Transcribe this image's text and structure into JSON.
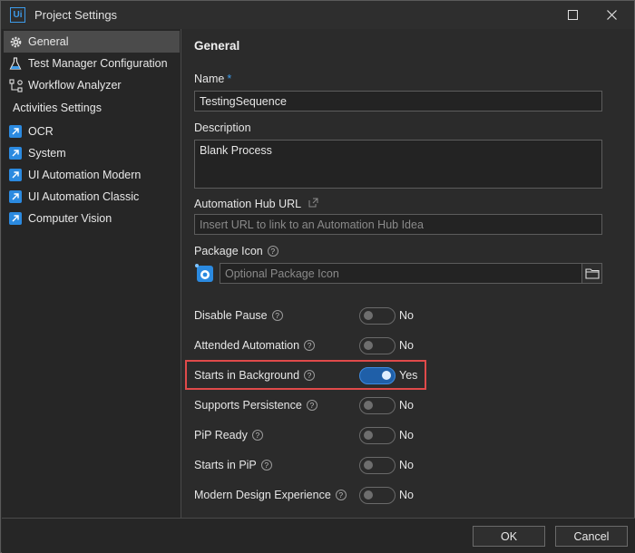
{
  "window": {
    "title": "Project Settings",
    "logo_text": "Ui"
  },
  "sidebar": {
    "items": [
      {
        "label": "General",
        "icon": "gear-icon",
        "active": true
      },
      {
        "label": "Test Manager Configuration",
        "icon": "flask-icon"
      },
      {
        "label": "Workflow Analyzer",
        "icon": "workflow-icon"
      }
    ],
    "activities_heading": "Activities Settings",
    "activities": [
      {
        "label": "OCR",
        "icon": "activity-package-icon"
      },
      {
        "label": "System",
        "icon": "activity-package-icon"
      },
      {
        "label": "UI Automation Modern",
        "icon": "activity-package-icon"
      },
      {
        "label": "UI Automation Classic",
        "icon": "activity-package-icon"
      },
      {
        "label": "Computer Vision",
        "icon": "activity-package-icon"
      }
    ]
  },
  "main": {
    "title": "General",
    "name_label": "Name",
    "name_required": "*",
    "name_value": "TestingSequence",
    "description_label": "Description",
    "description_value": "Blank Process",
    "hub_label": "Automation Hub URL",
    "hub_placeholder": "Insert URL to link to an Automation Hub Idea",
    "package_icon_label": "Package Icon",
    "package_icon_placeholder": "Optional Package Icon",
    "help_glyph": "?",
    "toggles": [
      {
        "label": "Disable Pause",
        "value": "No",
        "on": false
      },
      {
        "label": "Attended Automation",
        "value": "No",
        "on": false
      },
      {
        "label": "Starts in Background",
        "value": "Yes",
        "on": true
      },
      {
        "label": "Supports Persistence",
        "value": "No",
        "on": false
      },
      {
        "label": "PiP Ready",
        "value": "No",
        "on": false
      },
      {
        "label": "Starts in PiP",
        "value": "No",
        "on": false
      },
      {
        "label": "Modern Design Experience",
        "value": "No",
        "on": false
      }
    ]
  },
  "footer": {
    "ok_label": "OK",
    "cancel_label": "Cancel"
  },
  "colors": {
    "accent": "#3d9be9",
    "toggle_on": "#1f5fa8",
    "highlight": "#e04a4a"
  }
}
